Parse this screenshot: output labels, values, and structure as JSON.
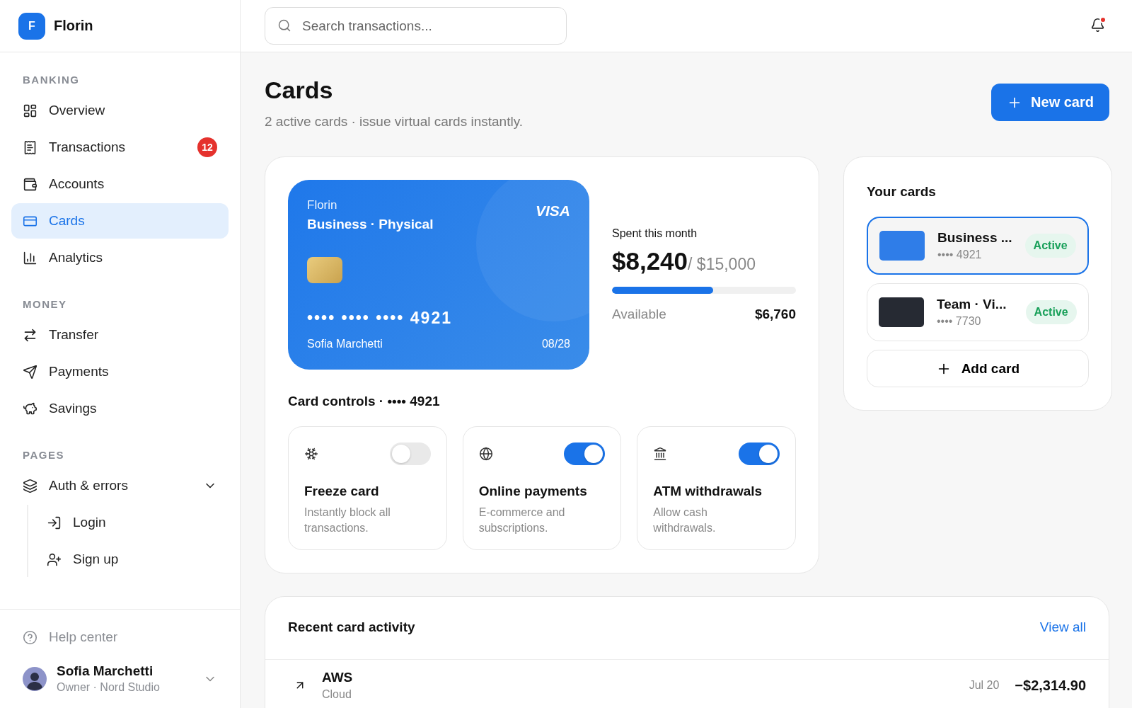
{
  "brand": {
    "initial": "F",
    "name": "Florin"
  },
  "sidebar": {
    "sections": [
      {
        "title": "BANKING",
        "items": [
          {
            "label": "Overview",
            "selected": false
          },
          {
            "label": "Transactions",
            "selected": false,
            "badge": "12"
          },
          {
            "label": "Accounts",
            "selected": false
          },
          {
            "label": "Cards",
            "selected": true
          },
          {
            "label": "Analytics",
            "selected": false
          }
        ]
      },
      {
        "title": "MONEY",
        "items": [
          {
            "label": "Transfer",
            "selected": false
          },
          {
            "label": "Payments",
            "selected": false
          },
          {
            "label": "Savings",
            "selected": false
          }
        ]
      },
      {
        "title": "PAGES",
        "items": [
          {
            "label": "Auth & errors",
            "selected": false,
            "expanded": true,
            "children": [
              {
                "label": "Login",
                "selected": false
              },
              {
                "label": "Sign up",
                "selected": false
              }
            ]
          }
        ]
      }
    ],
    "help": {
      "label": "Help center"
    },
    "user": {
      "name": "Sofia Marchetti",
      "role": "Owner · Nord Studio"
    }
  },
  "header": {
    "search": {
      "placeholder": "Search transactions..."
    },
    "notifications": {
      "unread": true
    }
  },
  "page": {
    "title": "Cards",
    "subtitle": "2 active cards · issue virtual cards instantly.",
    "action": "New card"
  },
  "card": {
    "issuer": "Florin",
    "title": "Business · Physical",
    "network": "VISA",
    "number": "•••• •••• •••• 4921",
    "holder": "Sofia Marchetti",
    "expiry": "08/28"
  },
  "spend": {
    "label": "Spent this month",
    "amount": "$8,240",
    "limit": "/ $15,000",
    "level": 0.55,
    "available_label": "Available",
    "available": "$6,760"
  },
  "controls": {
    "title": "Card controls · •••• 4921",
    "items": [
      {
        "title": "Freeze card",
        "description": "Instantly block all transactions.",
        "on": false
      },
      {
        "title": "Online payments",
        "description": "E-commerce and subscriptions.",
        "on": true
      },
      {
        "title": "ATM withdrawals",
        "description": "Allow cash withdrawals.",
        "on": true
      }
    ]
  },
  "your_cards": {
    "title": "Your cards",
    "items": [
      {
        "name": "Business ...",
        "number": "•••• 4921",
        "status": "Active",
        "color": "#2f7de8",
        "selected": true
      },
      {
        "name": "Team · Vi...",
        "number": "•••• 7730",
        "status": "Active",
        "color": "#262a33",
        "selected": false
      }
    ],
    "add": "Add card"
  },
  "activity": {
    "title": "Recent card activity",
    "link": "View all",
    "rows": [
      {
        "merchant": "AWS",
        "category": "Cloud",
        "date": "Jul 20",
        "amount": "−$2,314.90"
      }
    ]
  }
}
